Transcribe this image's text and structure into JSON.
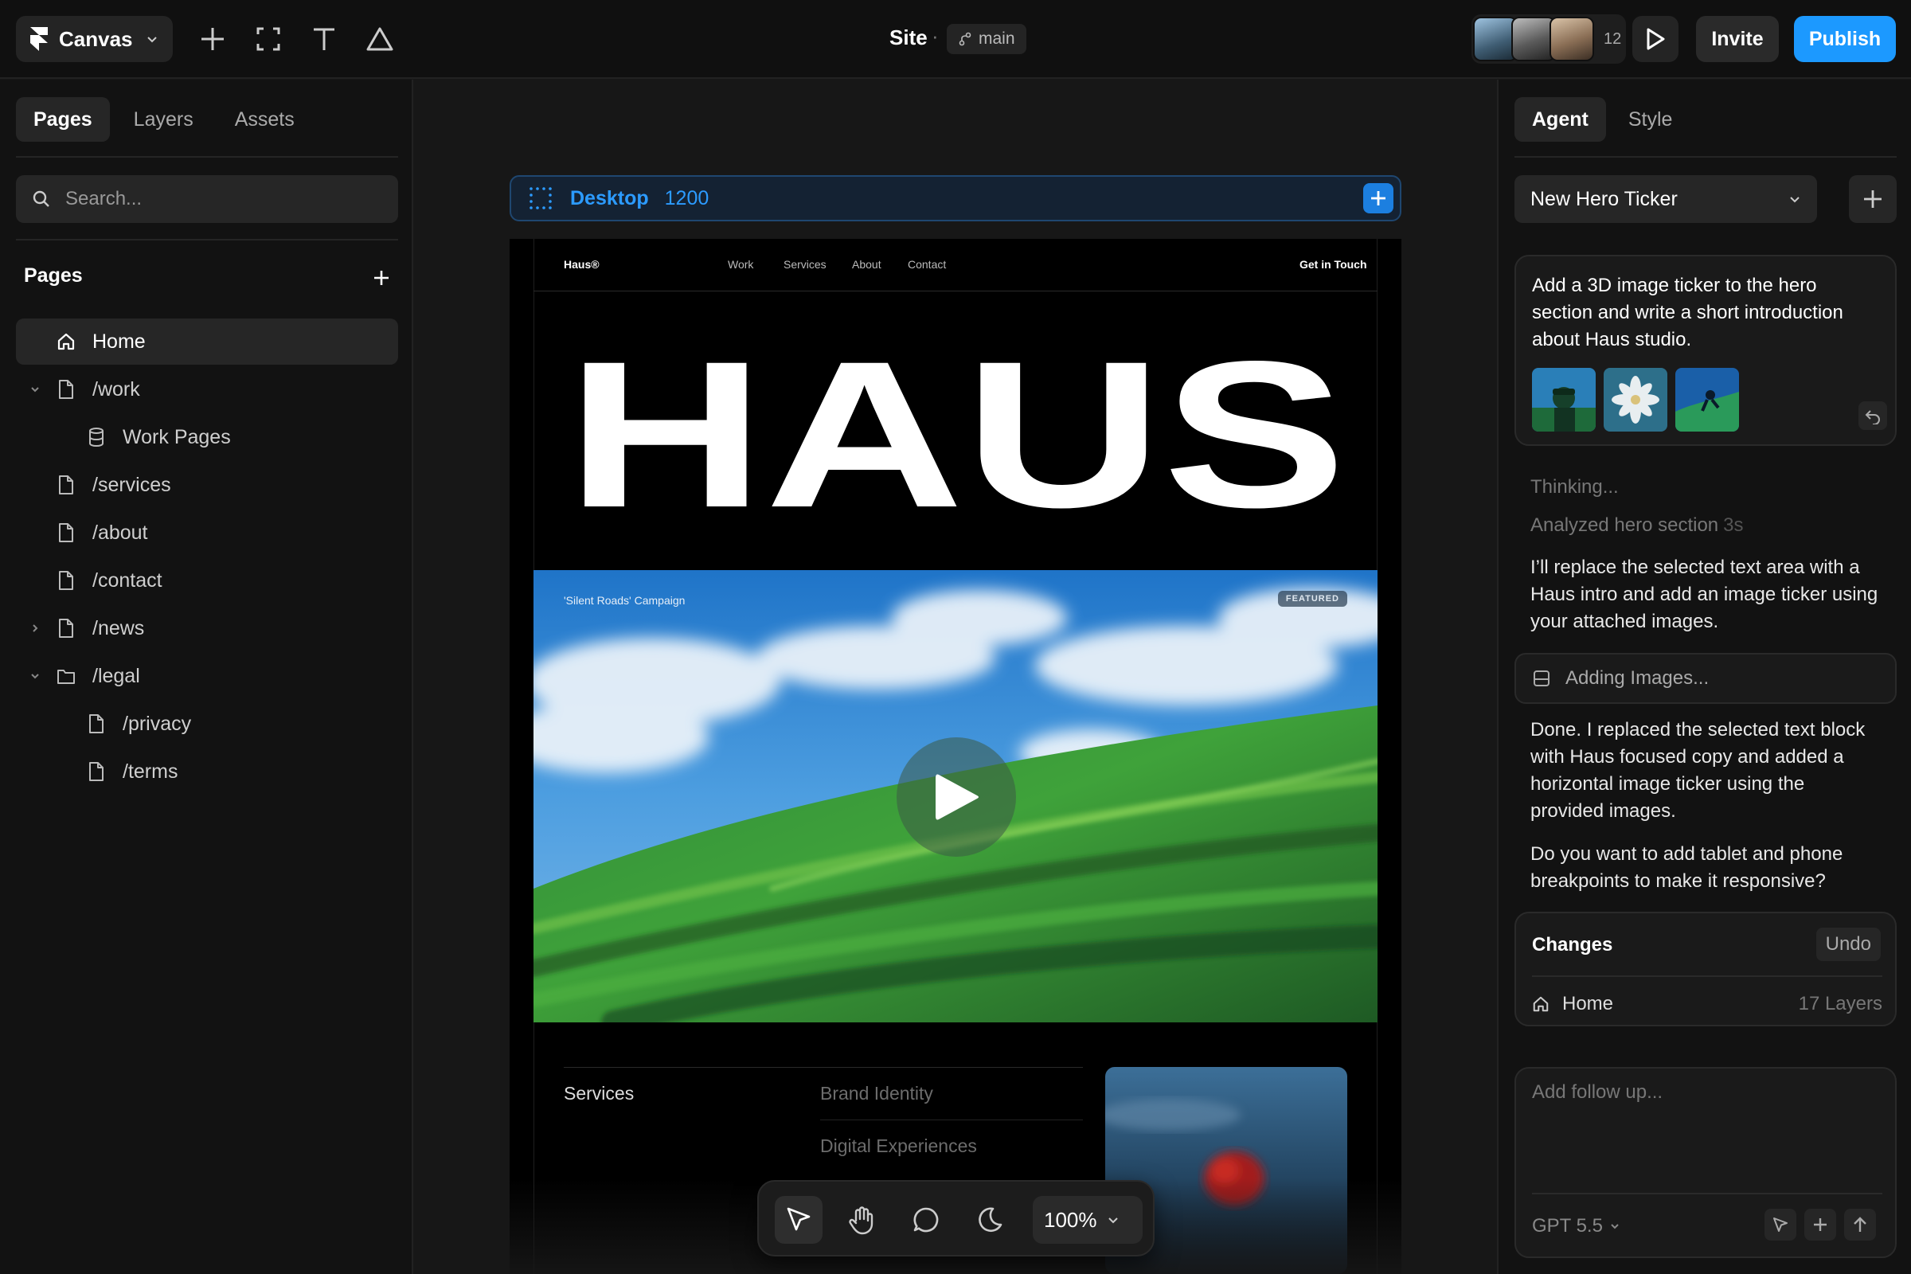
{
  "topbar": {
    "canvas_label": "Canvas",
    "site_title": "Site",
    "separator": "·",
    "branch": "main",
    "collaborator_count": "12",
    "invite_label": "Invite",
    "publish_label": "Publish"
  },
  "left_panel": {
    "tabs": [
      "Pages",
      "Layers",
      "Assets"
    ],
    "search_placeholder": "Search...",
    "pages_header": "Pages",
    "pages": [
      {
        "label": "Home",
        "icon": "home-icon"
      },
      {
        "label": "/work",
        "icon": "page-icon"
      },
      {
        "label": "Work Pages",
        "icon": "database-icon"
      },
      {
        "label": "/services",
        "icon": "page-icon"
      },
      {
        "label": "/about",
        "icon": "page-icon"
      },
      {
        "label": "/contact",
        "icon": "page-icon"
      },
      {
        "label": "/news",
        "icon": "page-icon"
      },
      {
        "label": "/legal",
        "icon": "folder-icon"
      },
      {
        "label": "/privacy",
        "icon": "page-icon"
      },
      {
        "label": "/terms",
        "icon": "page-icon"
      }
    ]
  },
  "canvas": {
    "breakpoint_name": "Desktop",
    "breakpoint_width": "1200",
    "site": {
      "logo": "Haus®",
      "nav": [
        "Work",
        "Services",
        "About",
        "Contact"
      ],
      "cta": "Get in Touch",
      "hero_word": "HAUS",
      "campaign_label": "'Silent Roads' Campaign",
      "featured_badge": "FEATURED",
      "services_heading": "Services",
      "services_items": [
        "Brand Identity",
        "Digital Experiences"
      ]
    },
    "zoom": "100%"
  },
  "right_panel": {
    "tabs": [
      "Agent",
      "Style"
    ],
    "thread_title": "New Hero Ticker",
    "user_message": "Add a 3D image ticker to the hero section and write a short introduction about Haus studio.",
    "status_thinking": "Thinking...",
    "status_analyzed": "Analyzed hero section",
    "status_analyzed_time": "3s",
    "agent_reply_1": "I’ll replace the selected text area with a Haus intro and add an image ticker using your attached images.",
    "tool_call_label": "Adding Images...",
    "agent_reply_2": "Done. I replaced the selected text block with Haus focused copy and added a horizontal image ticker using the provided images.",
    "agent_reply_3": "Do you want to add tablet and phone breakpoints to make it responsive?",
    "changes": {
      "title": "Changes",
      "undo_label": "Undo",
      "page": "Home",
      "layer_count": "17 Layers"
    },
    "composer_placeholder": "Add follow up...",
    "model": "GPT 5.5"
  },
  "colors": {
    "accent_blue": "#1c99ff",
    "panel_bg": "#121212",
    "canvas_bg": "#171717"
  }
}
